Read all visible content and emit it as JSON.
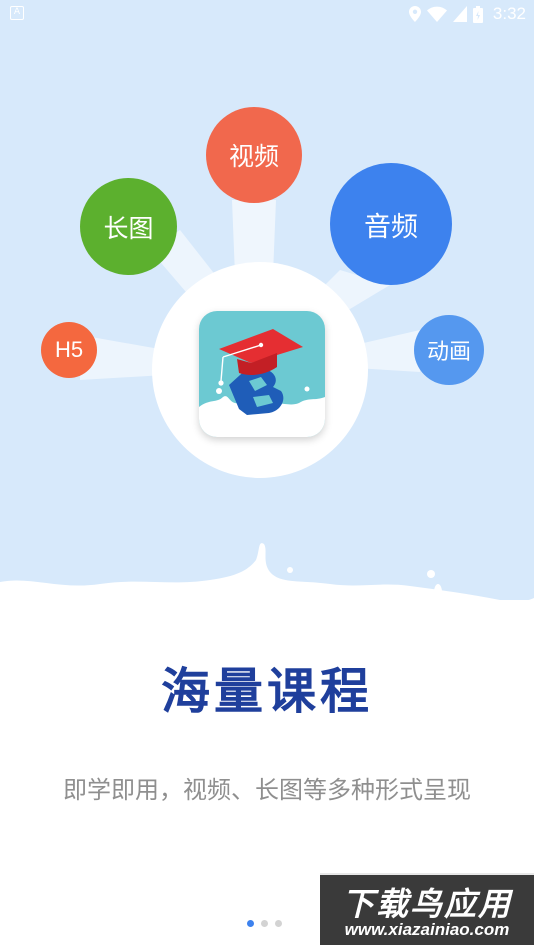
{
  "status_bar": {
    "time": "3:32",
    "left_icon": "A"
  },
  "feature_bubbles": {
    "video": "视频",
    "long_image": "长图",
    "audio": "音频",
    "h5": "H5",
    "animation": "动画"
  },
  "slide": {
    "title": "海量课程",
    "subtitle": "即学即用，视频、长图等多种形式呈现"
  },
  "pager": {
    "total": 3,
    "active_index": 0
  },
  "watermark": {
    "title": "下载鸟应用",
    "url": "www.xiazainiao.com"
  },
  "colors": {
    "background_top": "#d7e9fb",
    "video": "#f1684d",
    "long_image": "#5cb02e",
    "audio": "#3d82ee",
    "h5": "#f4683f",
    "animation": "#5598ef",
    "title": "#1f3f9c",
    "subtitle": "#8f8f8f"
  },
  "icons": [
    "notification-icon",
    "location-icon",
    "wifi-icon",
    "signal-icon",
    "battery-icon",
    "app-logo-graduation-cap"
  ]
}
